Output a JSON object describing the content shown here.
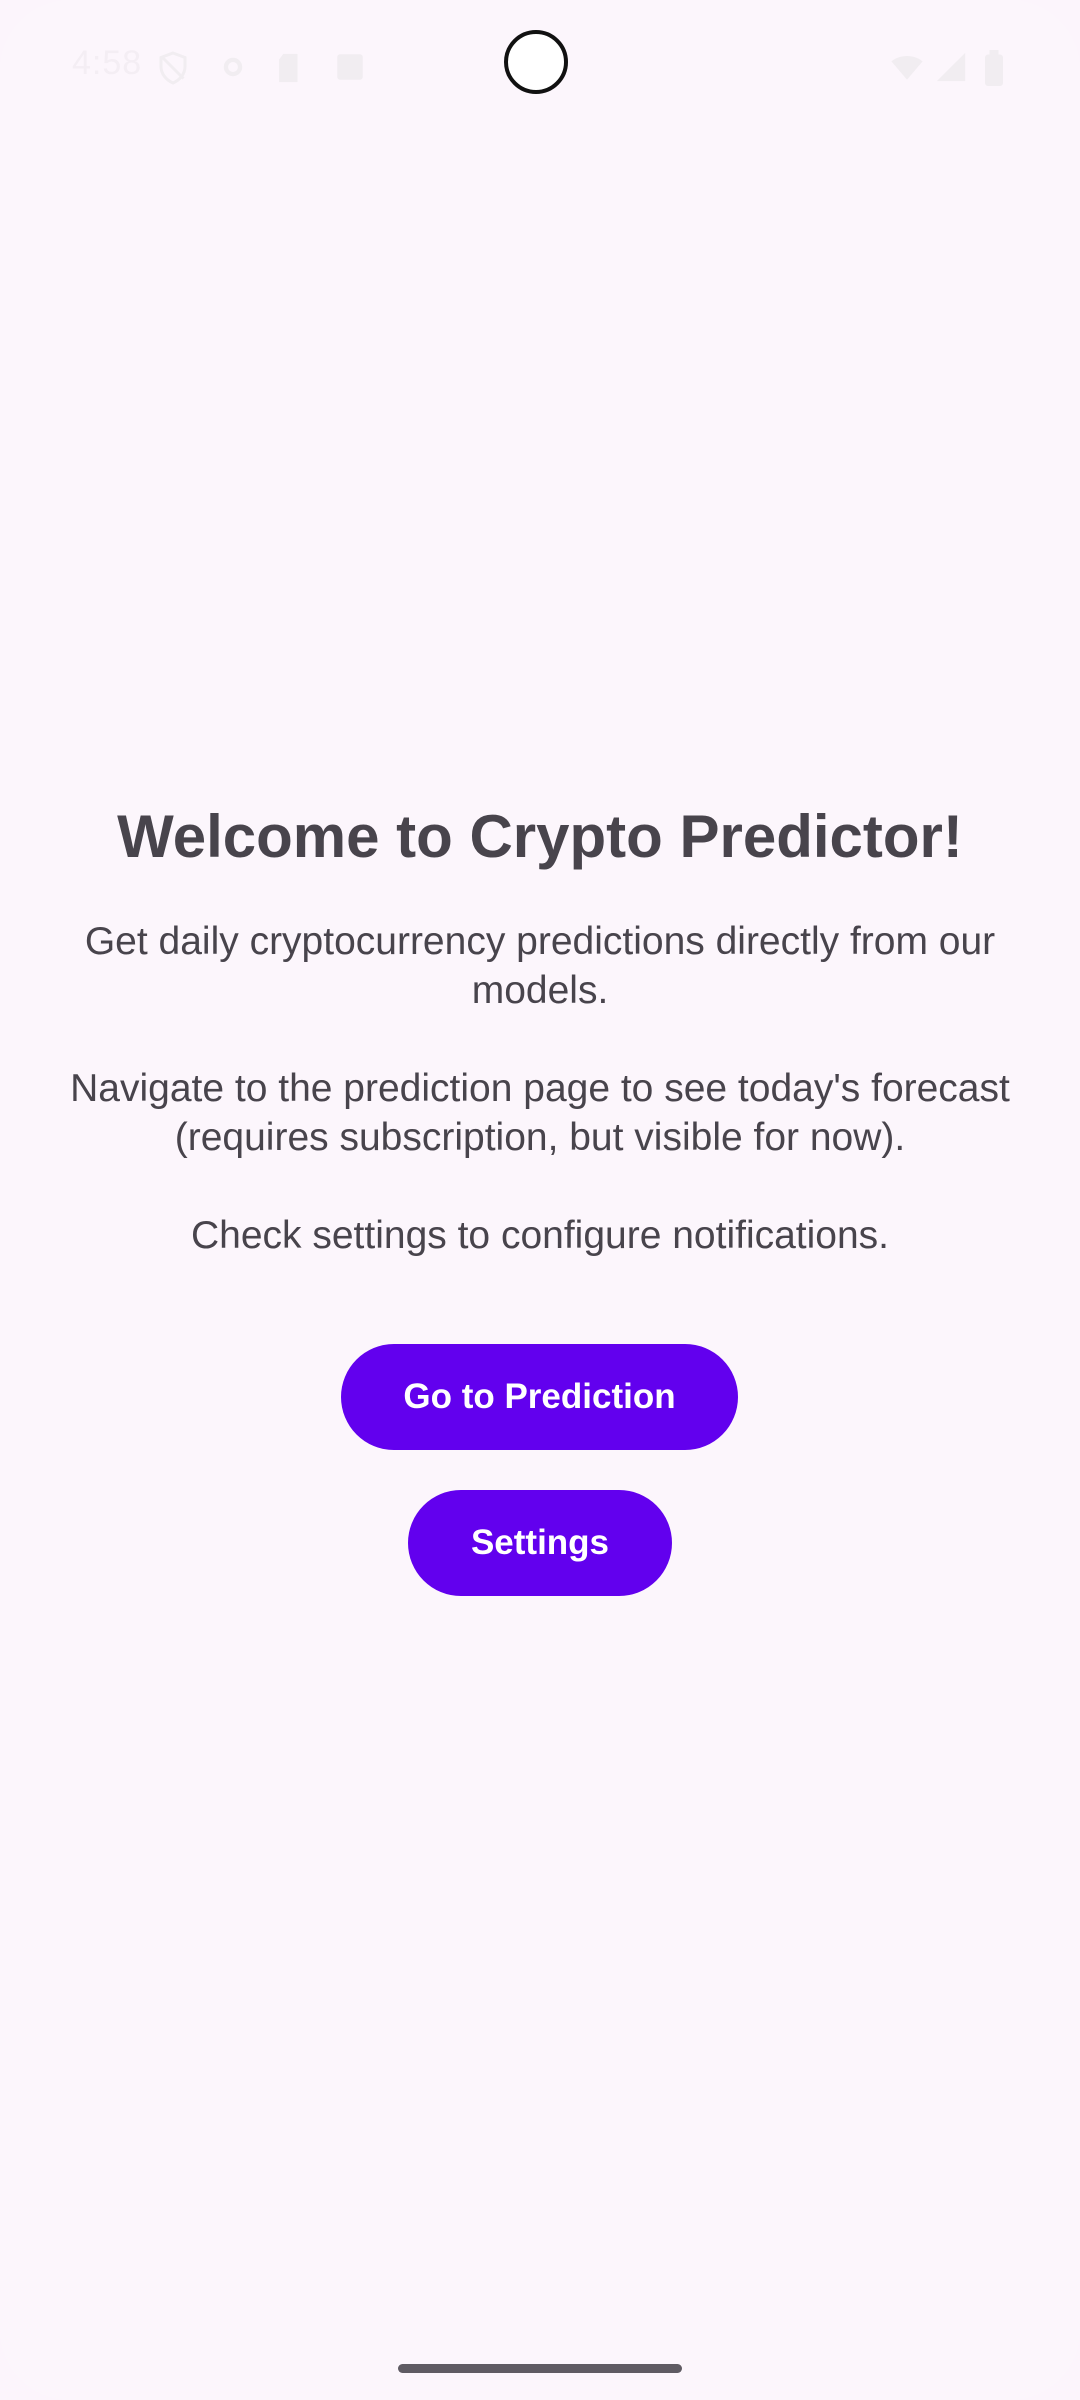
{
  "status_bar": {
    "time": "4:58"
  },
  "home": {
    "title": "Welcome to Crypto Predictor!",
    "description": "Get daily cryptocurrency predictions directly from our models.\n\nNavigate to the prediction page to see today's forecast (requires subscription, but visible for now).\n\nCheck settings to configure notifications.",
    "prediction_button_label": "Go to Prediction",
    "settings_button_label": "Settings"
  },
  "colors": {
    "background": "#FCF6FC",
    "primary": "#6200EE",
    "text": "#48444C"
  },
  "icons": [
    "shield-icon",
    "gear-icon",
    "sd-card-icon",
    "image-icon",
    "wifi-icon",
    "signal-icon",
    "battery-icon"
  ]
}
